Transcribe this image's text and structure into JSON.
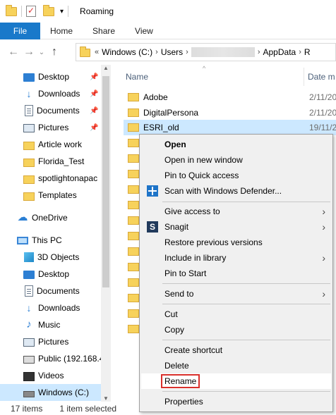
{
  "window": {
    "title": "Roaming"
  },
  "ribbon": {
    "tabs": [
      "File",
      "Home",
      "Share",
      "View"
    ]
  },
  "address": {
    "prefix": "«",
    "crumbs": [
      "Windows (C:)",
      "Users",
      "AppData",
      "R"
    ]
  },
  "nav": {
    "items": [
      {
        "label": "Desktop",
        "icon": "desktop-icon",
        "pinned": true
      },
      {
        "label": "Downloads",
        "icon": "downloads-icon",
        "pinned": true
      },
      {
        "label": "Documents",
        "icon": "documents-icon",
        "pinned": true
      },
      {
        "label": "Pictures",
        "icon": "pictures-icon",
        "pinned": true
      },
      {
        "label": "Article work",
        "icon": "folder-icon"
      },
      {
        "label": "Florida_Test",
        "icon": "folder-icon"
      },
      {
        "label": "spotlightonapac",
        "icon": "folder-icon"
      },
      {
        "label": "Templates",
        "icon": "folder-icon"
      },
      {
        "label": "OneDrive",
        "icon": "onedrive-icon"
      },
      {
        "label": "This PC",
        "icon": "this-pc-icon"
      },
      {
        "label": "3D Objects",
        "icon": "3d-objects-icon"
      },
      {
        "label": "Desktop",
        "icon": "desktop-icon"
      },
      {
        "label": "Documents",
        "icon": "documents-icon"
      },
      {
        "label": "Downloads",
        "icon": "downloads-icon"
      },
      {
        "label": "Music",
        "icon": "music-icon"
      },
      {
        "label": "Pictures",
        "icon": "pictures-icon"
      },
      {
        "label": "Public (192.168.4",
        "icon": "network-drive-icon"
      },
      {
        "label": "Videos",
        "icon": "videos-icon"
      },
      {
        "label": "Windows (C:)",
        "icon": "drive-icon",
        "selected": true
      }
    ]
  },
  "content": {
    "columns": {
      "name": "Name",
      "date": "Date m"
    },
    "files": [
      {
        "name": "Adobe",
        "date": "2/11/20"
      },
      {
        "name": "DigitalPersona",
        "date": "2/11/20"
      },
      {
        "name": "ESRI_old",
        "date": "19/11/2",
        "selected": true
      },
      {
        "name": "",
        "date": ""
      },
      {
        "name": "",
        "date": ""
      },
      {
        "name": "",
        "date": ""
      },
      {
        "name": "",
        "date": ""
      },
      {
        "name": "",
        "date": ""
      },
      {
        "name": "",
        "date": ""
      },
      {
        "name": "",
        "date": ""
      },
      {
        "name": "",
        "date": ""
      },
      {
        "name": "",
        "date": ""
      },
      {
        "name": "",
        "date": ""
      },
      {
        "name": "",
        "date": ""
      },
      {
        "name": "",
        "date": ""
      }
    ]
  },
  "status": {
    "count": "17 items",
    "selection": "1 item selected"
  },
  "context_menu": {
    "items": [
      {
        "label": "Open",
        "bold": true
      },
      {
        "label": "Open in new window"
      },
      {
        "label": "Pin to Quick access"
      },
      {
        "label": "Scan with Windows Defender...",
        "icon": "windows-defender-icon"
      },
      {
        "label": "Give access to",
        "submenu": true
      },
      {
        "label": "Snagit",
        "icon": "snagit-icon",
        "submenu": true
      },
      {
        "label": "Restore previous versions"
      },
      {
        "label": "Include in library",
        "submenu": true
      },
      {
        "label": "Pin to Start"
      },
      {
        "label": "Send to",
        "submenu": true
      },
      {
        "label": "Cut"
      },
      {
        "label": "Copy"
      },
      {
        "label": "Create shortcut"
      },
      {
        "label": "Delete"
      },
      {
        "label": "Rename",
        "highlighted": true
      },
      {
        "label": "Properties"
      }
    ]
  },
  "colors": {
    "accent": "#1979ca",
    "selection": "#cce8ff",
    "rename_outline": "#d9302c"
  }
}
